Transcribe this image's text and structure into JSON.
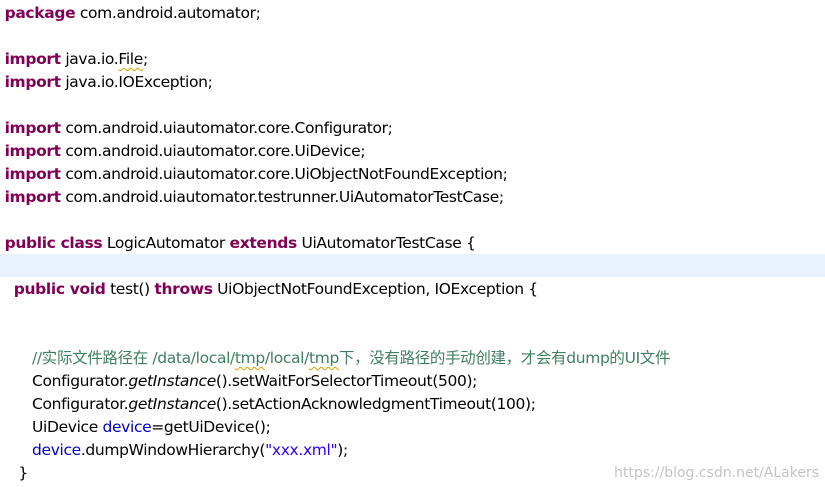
{
  "code": {
    "package_kw": "package",
    "package_name": "com.android.automator;",
    "import_kw": "import",
    "imports": [
      {
        "pre": "java.io.",
        "squiggle": "File",
        "post": ";"
      },
      {
        "pre": "java.io.IOException;",
        "squiggle": "",
        "post": ""
      },
      {
        "pre": "com.android.uiautomator.core.Configurator;",
        "squiggle": "",
        "post": ""
      },
      {
        "pre": "com.android.uiautomator.core.UiDevice;",
        "squiggle": "",
        "post": ""
      },
      {
        "pre": "com.android.uiautomator.core.UiObjectNotFoundException;",
        "squiggle": "",
        "post": ""
      },
      {
        "pre": "com.android.uiautomator.testrunner.UiAutomatorTestCase;",
        "squiggle": "",
        "post": ""
      }
    ],
    "class_decl": {
      "kw_public_class": "public class",
      "name": "LogicAutomator",
      "kw_extends": "extends",
      "rest": "UiAutomatorTestCase {"
    },
    "method_decl": {
      "kw_public_void": "public void",
      "name": "test()",
      "kw_throws": "throws",
      "rest": "UiObjectNotFoundException, IOException {"
    },
    "comment": {
      "part1": "//实际文件路径在 /data/local/",
      "squiggle1": "tmp",
      "part2": "/local/",
      "squiggle2": "tmp",
      "part3": "下，没有路径的手动创建，才会有dump的UI文件"
    },
    "stmt1": {
      "cls": "Configurator.",
      "method": "getInstance",
      "rest": "().setWaitForSelectorTimeout(500);"
    },
    "stmt2": {
      "cls": "Configurator.",
      "method": "getInstance",
      "rest": "().setActionAcknowledgmentTimeout(100);"
    },
    "stmt3": {
      "type": "UiDevice ",
      "var": "device",
      "rest": "=getUiDevice();"
    },
    "stmt4": {
      "var": "device",
      "call": ".dumpWindowHierarchy(",
      "str": "\"xxx.xml\"",
      "end": ");"
    },
    "close_brace": "}"
  },
  "colors": {
    "keyword": "#7f0055",
    "field": "#0000c0",
    "string": "#2a00ff",
    "comment": "#3f7f5f",
    "current_line": "#e8f2fe"
  },
  "watermark": "https://blog.csdn.net/ALakers"
}
